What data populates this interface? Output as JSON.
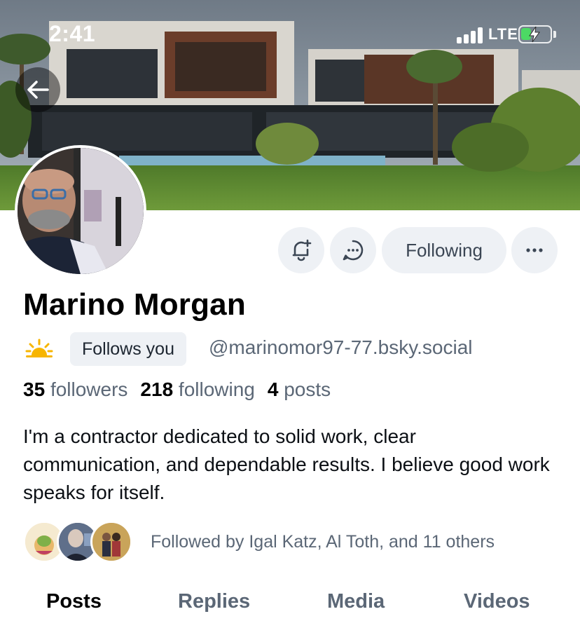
{
  "status_bar": {
    "time": "2:41",
    "network": "LTE",
    "battery_level": 0.35
  },
  "profile": {
    "display_name": "Marino Morgan",
    "follows_you_label": "Follows you",
    "handle": "@marinomor97-77.bsky.social",
    "stats": {
      "followers_count": "35",
      "followers_label": "followers",
      "following_count": "218",
      "following_label": "following",
      "posts_count": "4",
      "posts_label": "posts"
    },
    "bio": "I'm a contractor dedicated to solid work, clear communication, and dependable results. I believe good work speaks for itself.",
    "followed_by": "Followed by Igal Katz, Al Toth, and 11 others"
  },
  "actions": {
    "following_label": "Following"
  },
  "tabs": [
    {
      "label": "Posts",
      "active": true
    },
    {
      "label": "Replies",
      "active": false
    },
    {
      "label": "Media",
      "active": false
    },
    {
      "label": "Videos",
      "active": false
    }
  ],
  "icons": {
    "back": "arrow-left-icon",
    "notify": "bell-plus-icon",
    "message": "chat-bubble-icon",
    "more": "ellipsis-icon",
    "pronoun_emoji": "sun-icon"
  },
  "colors": {
    "button_bg": "#eef1f5",
    "muted_text": "#5b6776",
    "battery_green": "#4cd964"
  }
}
